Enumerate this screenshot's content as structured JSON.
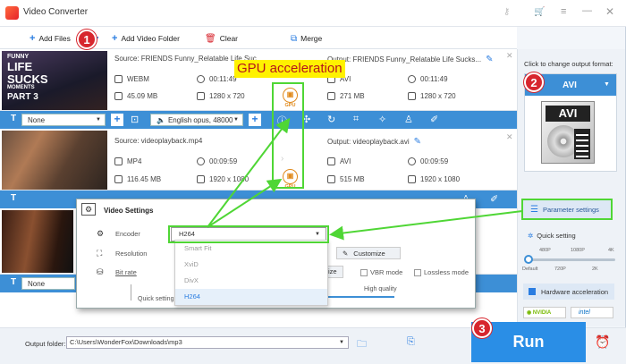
{
  "app": {
    "title": "Video Converter"
  },
  "toolbar": {
    "add_files": "Add Files",
    "add_video_folder": "Add Video Folder",
    "clear": "Clear",
    "merge": "Merge"
  },
  "callouts": {
    "gpu_acceleration": "GPU acceleration",
    "badge1": "1",
    "badge2": "2",
    "badge3": "3"
  },
  "files": [
    {
      "thumb_text": [
        "FUNNY",
        "LIFE",
        "SUCKS",
        "MOMENTS",
        "PART 3"
      ],
      "source": "Source: FRIENDS Funny_Relatable Life Suc...",
      "output": "Output: FRIENDS Funny_Relatable Life Sucks...",
      "src_format": "WEBM",
      "src_duration": "00:11:49",
      "src_size": "45.09 MB",
      "src_res": "1280 x 720",
      "out_format": "AVI",
      "out_duration": "00:11:49",
      "out_size": "271 MB",
      "out_res": "1280 x 720",
      "gpu": "GPU"
    },
    {
      "source": "Source: videoplayback.mp4",
      "output": "Output: videoplayback.avi",
      "src_format": "MP4",
      "src_duration": "00:09:59",
      "src_size": "116.45 MB",
      "src_res": "1920 x 1080",
      "out_format": "AVI",
      "out_duration": "00:09:59",
      "out_size": "515 MB",
      "out_res": "1920 x 1080",
      "gpu": "GPU"
    }
  ],
  "file_bar": {
    "subtitle": "None",
    "audio": "English opus, 48000"
  },
  "file3_bar": {
    "subtitle": "None"
  },
  "right_panel": {
    "click_to_change": "Click to change output format:",
    "format": "AVI",
    "format_icon_text": "AVI",
    "param_settings": "Parameter settings",
    "quick_setting": "Quick setting",
    "ticks_top": [
      "480P",
      "1080P",
      "4K"
    ],
    "ticks_bottom": [
      "Default",
      "720P",
      "2K"
    ],
    "hw_accel": "Hardware acceleration",
    "nvidia": "NVIDIA",
    "intel": "intel"
  },
  "dialog": {
    "title": "Video Settings",
    "encoder_label": "Encoder",
    "encoder_value": "H264",
    "resolution_label": "Resolution",
    "bitrate_label": "Bit rate",
    "customize": "Customize",
    "size_frag": "ize",
    "vbr": "VBR mode",
    "lossless": "Lossless mode",
    "high_quality": "High quality",
    "quick_setting": "Quick setting",
    "options": [
      "Smart Fit",
      "XviD",
      "DivX",
      "H264"
    ]
  },
  "bottom": {
    "output_folder_label": "Output folder:",
    "output_folder_path": "C:\\Users\\WonderFox\\Downloads\\mp3",
    "run": "Run"
  },
  "colors": {
    "accent": "#3d8fd6",
    "run_bg": "#2a8ee6",
    "callout_yellow": "#fff200",
    "callout_green": "#4fd635",
    "badge_red": "#d7262e",
    "gpu_orange": "#e08a1d"
  }
}
